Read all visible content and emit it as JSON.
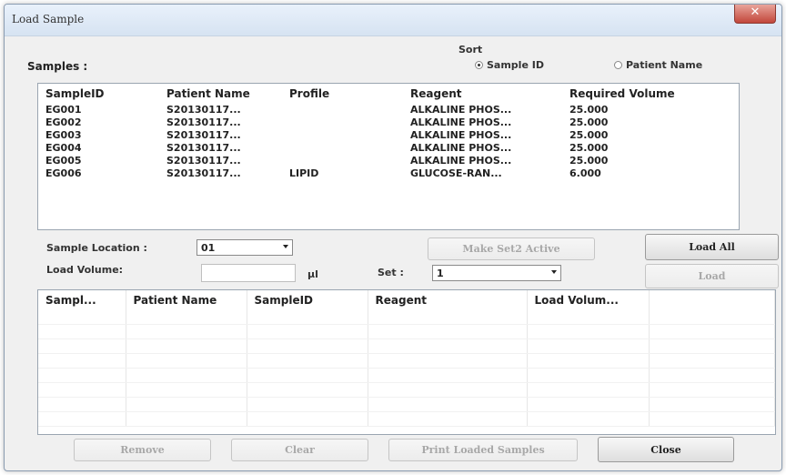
{
  "window": {
    "title": "Load Sample"
  },
  "samples_label": "Samples :",
  "sort": {
    "label": "Sort",
    "options": [
      "Sample ID",
      "Patient Name"
    ],
    "selected": "Sample ID"
  },
  "samples_table": {
    "columns": [
      "SampleID",
      "Patient Name",
      "Profile",
      "Reagent",
      "Required Volume"
    ],
    "rows": [
      [
        "EG001",
        "S20130117...",
        "",
        "ALKALINE PHOS...",
        "25.000"
      ],
      [
        "EG002",
        "S20130117...",
        "",
        "ALKALINE PHOS...",
        "25.000"
      ],
      [
        "EG003",
        "S20130117...",
        "",
        "ALKALINE PHOS...",
        "25.000"
      ],
      [
        "EG004",
        "S20130117...",
        "",
        "ALKALINE PHOS...",
        "25.000"
      ],
      [
        "EG005",
        "S20130117...",
        "",
        "ALKALINE PHOS...",
        "25.000"
      ],
      [
        "EG006",
        "S20130117...",
        "LIPID",
        "GLUCOSE-RAN...",
        "6.000"
      ]
    ]
  },
  "sample_location": {
    "label": "Sample Location :",
    "value": "01"
  },
  "make_set2_active_label": "Make Set2 Active",
  "load_all_label": "Load All",
  "load_volume": {
    "label": "Load Volume:",
    "value": "",
    "unit": "µl"
  },
  "set": {
    "label": "Set :",
    "value": "1"
  },
  "load_label": "Load",
  "loaded_table": {
    "columns": [
      "Sampl...",
      "Patient Name",
      "SampleID",
      "Reagent",
      "Load Volum..."
    ]
  },
  "buttons": {
    "remove": "Remove",
    "clear": "Clear",
    "print_loaded": "Print Loaded Samples",
    "close": "Close"
  }
}
